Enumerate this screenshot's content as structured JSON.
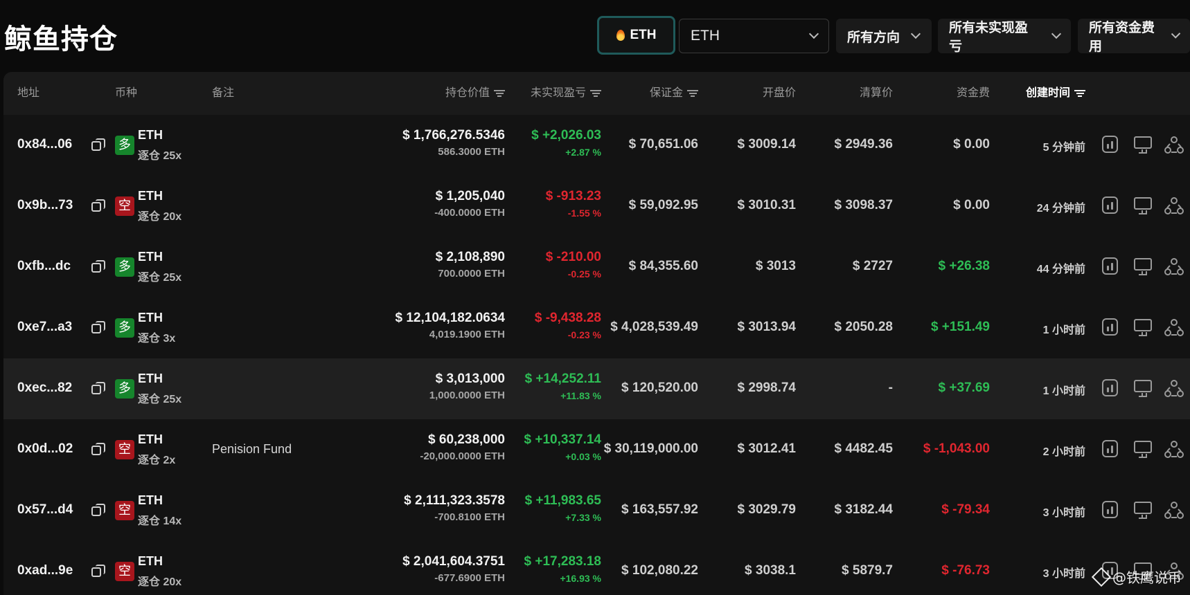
{
  "header": {
    "title": "鲸鱼持仓",
    "coin_chip": "ETH",
    "coin_select": "ETH",
    "filters": [
      "所有方向",
      "所有未实现盈亏",
      "所有资金费用"
    ]
  },
  "columns": {
    "address": "地址",
    "coin": "币种",
    "note": "备注",
    "position_value": "持仓价值",
    "unrealized_pnl": "未实现盈亏",
    "margin": "保证金",
    "open_price": "开盘价",
    "liq_price": "清算价",
    "funding": "资金费",
    "created": "创建时间"
  },
  "rows": [
    {
      "address": "0x84...06",
      "dir": "多",
      "side": "long",
      "coin": "ETH",
      "leverage": "逐仓 25x",
      "note": "",
      "value": "$ 1,766,276.5346",
      "size": "586.3000 ETH",
      "pnl": "$ +2,026.03",
      "pnl_pct": "+2.87 %",
      "pnl_sign": "pos",
      "margin": "$ 70,651.06",
      "open": "$ 3009.14",
      "liq": "$ 2949.36",
      "funding": "$ 0.00",
      "funding_sign": "",
      "created": "5 分钟前"
    },
    {
      "address": "0x9b...73",
      "dir": "空",
      "side": "short",
      "coin": "ETH",
      "leverage": "逐仓 20x",
      "note": "",
      "value": "$ 1,205,040",
      "size": "-400.0000 ETH",
      "pnl": "$ -913.23",
      "pnl_pct": "-1.55 %",
      "pnl_sign": "neg",
      "margin": "$ 59,092.95",
      "open": "$ 3010.31",
      "liq": "$ 3098.37",
      "funding": "$ 0.00",
      "funding_sign": "",
      "created": "24 分钟前"
    },
    {
      "address": "0xfb...dc",
      "dir": "多",
      "side": "long",
      "coin": "ETH",
      "leverage": "逐仓 25x",
      "note": "",
      "value": "$ 2,108,890",
      "size": "700.0000 ETH",
      "pnl": "$ -210.00",
      "pnl_pct": "-0.25 %",
      "pnl_sign": "neg",
      "margin": "$ 84,355.60",
      "open": "$ 3013",
      "liq": "$ 2727",
      "funding": "$ +26.38",
      "funding_sign": "pos",
      "created": "44 分钟前"
    },
    {
      "address": "0xe7...a3",
      "dir": "多",
      "side": "long",
      "coin": "ETH",
      "leverage": "逐仓 3x",
      "note": "",
      "value": "$ 12,104,182.0634",
      "size": "4,019.1900 ETH",
      "pnl": "$ -9,438.28",
      "pnl_pct": "-0.23 %",
      "pnl_sign": "neg",
      "margin": "$ 4,028,539.49",
      "open": "$ 3013.94",
      "liq": "$ 2050.28",
      "funding": "$ +151.49",
      "funding_sign": "pos",
      "created": "1 小时前"
    },
    {
      "address": "0xec...82",
      "dir": "多",
      "side": "long",
      "coin": "ETH",
      "leverage": "逐仓 25x",
      "note": "",
      "value": "$ 3,013,000",
      "size": "1,000.0000 ETH",
      "pnl": "$ +14,252.11",
      "pnl_pct": "+11.83 %",
      "pnl_sign": "pos",
      "margin": "$ 120,520.00",
      "open": "$ 2998.74",
      "liq": "-",
      "funding": "$ +37.69",
      "funding_sign": "pos",
      "created": "1 小时前"
    },
    {
      "address": "0x0d...02",
      "dir": "空",
      "side": "short",
      "coin": "ETH",
      "leverage": "逐仓 2x",
      "note": "Penision Fund",
      "value": "$ 60,238,000",
      "size": "-20,000.0000 ETH",
      "pnl": "$ +10,337.14",
      "pnl_pct": "+0.03 %",
      "pnl_sign": "pos",
      "margin": "$ 30,119,000.00",
      "open": "$ 3012.41",
      "liq": "$ 4482.45",
      "funding": "$ -1,043.00",
      "funding_sign": "neg",
      "created": "2 小时前"
    },
    {
      "address": "0x57...d4",
      "dir": "空",
      "side": "short",
      "coin": "ETH",
      "leverage": "逐仓 14x",
      "note": "",
      "value": "$ 2,111,323.3578",
      "size": "-700.8100 ETH",
      "pnl": "$ +11,983.65",
      "pnl_pct": "+7.33 %",
      "pnl_sign": "pos",
      "margin": "$ 163,557.92",
      "open": "$ 3029.79",
      "liq": "$ 3182.44",
      "funding": "$ -79.34",
      "funding_sign": "neg",
      "created": "3 小时前"
    },
    {
      "address": "0xad...9e",
      "dir": "空",
      "side": "short",
      "coin": "ETH",
      "leverage": "逐仓 20x",
      "note": "",
      "value": "$ 2,041,604.3751",
      "size": "-677.6900 ETH",
      "pnl": "$ +17,283.18",
      "pnl_pct": "+16.93 %",
      "pnl_sign": "pos",
      "margin": "$ 102,080.22",
      "open": "$ 3038.1",
      "liq": "$ 5879.7",
      "funding": "$ -76.73",
      "funding_sign": "neg",
      "created": "3 小时前"
    }
  ],
  "highlight_row": 4,
  "watermark": "@铁鹰说币",
  "colors": {
    "positive": "#2ebd55",
    "negative": "#e0262f",
    "long": "#16852c",
    "short": "#a8161d",
    "chip_border": "#1f5a5a"
  }
}
